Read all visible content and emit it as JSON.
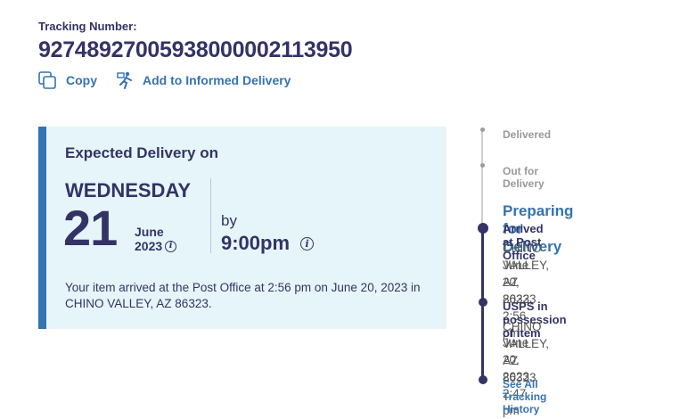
{
  "tracking": {
    "label": "Tracking Number:",
    "number": "9274892700593800000211395 0"
  },
  "actions": {
    "copy_label": "Copy",
    "informed_delivery_label": "Add to Informed Delivery"
  },
  "delivery": {
    "title": "Expected Delivery on",
    "weekday": "WEDNESDAY",
    "day": "21",
    "month": "June",
    "year": "2023",
    "by_label": "by",
    "time": "9:00pm",
    "message": "Your item arrived at the Post Office at 2:56 pm on June 20, 2023 in CHINO VALLEY, AZ 86323."
  },
  "timeline": {
    "delivered": "Delivered",
    "out_for_delivery": "Out for Delivery",
    "current_status": "Preparing for Delivery",
    "events": [
      {
        "title": "Arrived at Post Office",
        "location": "CHINO VALLEY, AZ 86323",
        "datetime": "June 20, 2023, 2:56 pm"
      },
      {
        "title": "USPS in possession of item",
        "location": "CHINO VALLEY, AZ 86323",
        "datetime": "June 20, 2023, 2:47 pm"
      }
    ],
    "history_link": "See All Tracking History"
  },
  "colors": {
    "navy": "#333366",
    "blue": "#3573b1",
    "card_bg": "#e6f5f9",
    "gray": "#999999"
  }
}
